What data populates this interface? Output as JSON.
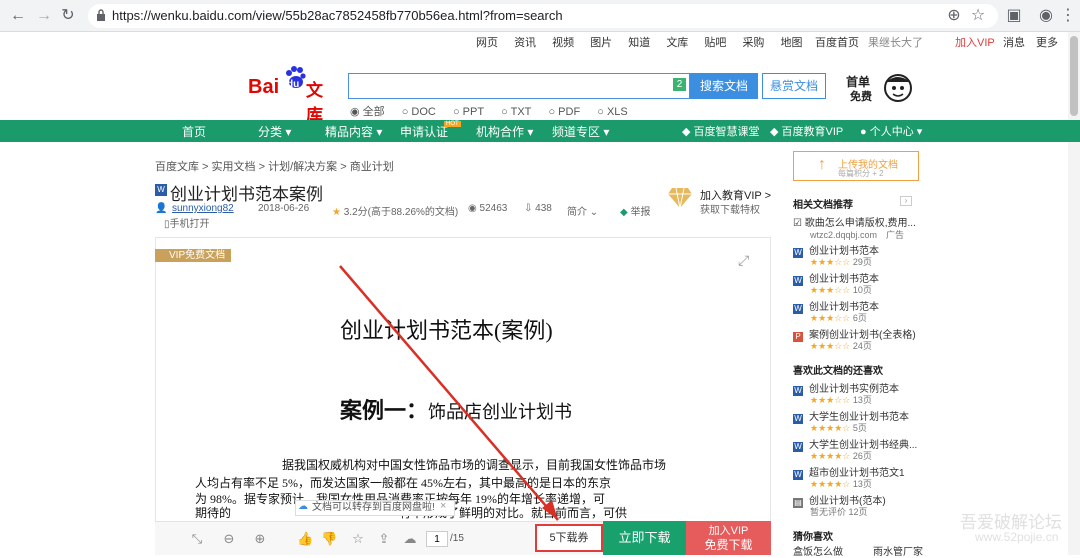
{
  "browser": {
    "url": "https://wenku.baidu.com/view/55b28ac7852458fb770b56ea.html?from=search",
    "back": "←",
    "forward": "→",
    "reload": "↻",
    "zoom": "⊕",
    "bookmark": "☆",
    "profile": "◉",
    "menu": "⋮"
  },
  "topnav": {
    "links": [
      "网页",
      "资讯",
      "视频",
      "图片",
      "知道",
      "文库",
      "贴吧",
      "采购",
      "地图"
    ],
    "home": "百度首页",
    "user": "果继长大了",
    "vip": "加入VIP",
    "messages": "消息",
    "more": "更多"
  },
  "logo": {
    "bai": "Bai",
    "du": "du",
    "wenku": "文库"
  },
  "search": {
    "value": "",
    "badge": "2",
    "button": "搜索文档",
    "reward": "悬赏文档",
    "promo_line1": "首单",
    "promo_line2": "免费"
  },
  "filters": [
    "全部",
    "DOC",
    "PPT",
    "TXT",
    "PDF",
    "XLS"
  ],
  "greennav": {
    "items": [
      "首页",
      "分类",
      "精品内容",
      "申请认证",
      "机构合作",
      "频道专区"
    ],
    "hot": "HOT",
    "right": [
      "百度智慧课堂",
      "百度教育VIP",
      "个人中心"
    ]
  },
  "breadcrumb": [
    "百度文库",
    "实用文档",
    "计划/解决方案",
    "商业计划"
  ],
  "doc": {
    "title": "创业计划书范本案例",
    "author": "sunnyxiong82",
    "mobile": "手机打开",
    "date": "2018-06-26",
    "rating": "3.2分(高于88.26%的文档)",
    "views": "52463",
    "downloads": "438",
    "intro": "简介",
    "report": "举报",
    "vip_promo_title": "加入教育VIP >",
    "vip_promo_sub": "获取下载特权"
  },
  "page": {
    "vip_tag": "VIP免费文档",
    "title": "创业计划书范本(案例)",
    "subtitle_a": "案例一：",
    "subtitle_b": "饰品店创业计划书",
    "lines": [
      "据我国权威机构对中国女性饰品市场的调查显示，目前我国女性饰品市场",
      "人均占有率不足 5%，而发达国家一般都在 45%左右，其中最高的是日本的东京",
      "为 98%。据专家预计，我国女性用品消费率正按每年 19%的年增长率递增，可",
      "期待的　　　　　　　　　　　　　　有率形成了鲜明的对比。就目前而言，可供"
    ],
    "tooltip": "文档可以转存到百度网盘啦!"
  },
  "toolbar": {
    "page_current": "1",
    "page_total": "/15",
    "coupon": "5下载券",
    "download": "立即下载",
    "vip_download_1": "加入VIP",
    "vip_download_2": "免费下载"
  },
  "sidebar": {
    "upload": "上传我的文档",
    "upload_sub": "每篇积分 + 2",
    "related_title": "相关文档推荐",
    "ad_title": "歌曲怎么申请版权,费用...",
    "ad_url": "wtzc2.dqqbj.com",
    "ad_label": "广告",
    "related": [
      {
        "title": "创业计划书范本",
        "reads": "29页",
        "stars": "★★★☆☆"
      },
      {
        "title": "创业计划书范本",
        "reads": "10页",
        "stars": "★★★☆☆"
      },
      {
        "title": "创业计划书范本",
        "reads": "6页",
        "stars": "★★★☆☆"
      },
      {
        "title": "案例创业计划书(全表格)",
        "reads": "24页",
        "stars": "★★★☆☆"
      }
    ],
    "also_title": "喜欢此文档的还喜欢",
    "also": [
      {
        "title": "创业计划书实例范本",
        "reads": "13页",
        "stars": "★★★☆☆"
      },
      {
        "title": "大学生创业计划书范本",
        "reads": "5页",
        "stars": "★★★★☆"
      },
      {
        "title": "大学生创业计划书经典...",
        "reads": "26页",
        "stars": "★★★★☆"
      },
      {
        "title": "超市创业计划书范文1",
        "reads": "13页",
        "stars": "★★★★☆"
      },
      {
        "title": "创业计划书(范本)",
        "reads": "12页",
        "stars": "暂无评价"
      }
    ],
    "guess_title": "猜你喜欢",
    "guess": [
      "盒饭怎么做",
      "雨水管厂家"
    ]
  },
  "watermark": {
    "line1": "吾爱破解论坛",
    "line2": "www.52pojie.cn"
  }
}
